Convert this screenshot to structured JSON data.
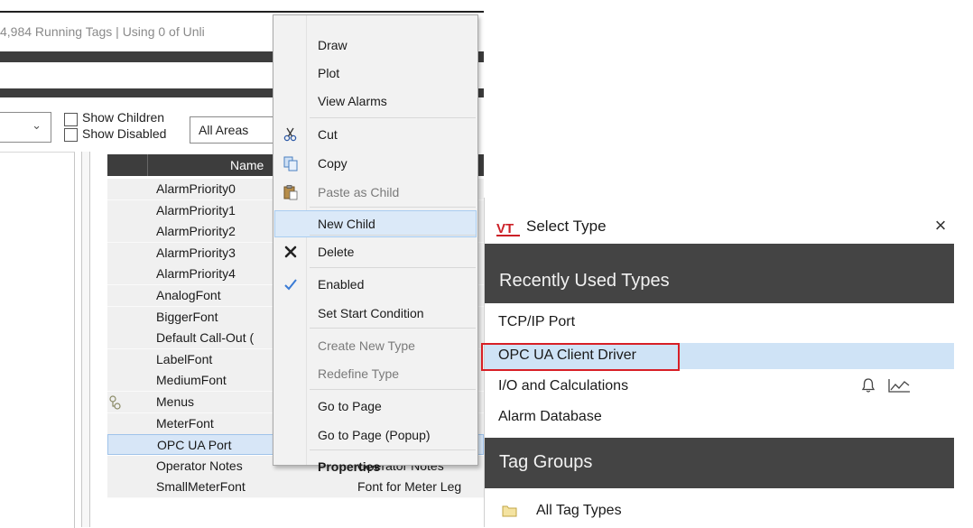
{
  "tag_browser": {
    "status_text": "4,984 Running Tags | Using 0 of Unli",
    "filters": {
      "show_children_label": "Show Children",
      "show_disabled_label": "Show Disabled",
      "area_value": "All Areas"
    },
    "grid": {
      "name_header": "Name",
      "rows": [
        {
          "name": "AlarmPriority0",
          "desc": ""
        },
        {
          "name": "AlarmPriority1",
          "desc": ""
        },
        {
          "name": "AlarmPriority2",
          "desc": ""
        },
        {
          "name": "AlarmPriority3",
          "desc": ""
        },
        {
          "name": "AlarmPriority4",
          "desc": ""
        },
        {
          "name": "AnalogFont",
          "desc": ""
        },
        {
          "name": "BiggerFont",
          "desc": ""
        },
        {
          "name": "Default Call-Out (",
          "desc": ""
        },
        {
          "name": "LabelFont",
          "desc": ""
        },
        {
          "name": "MediumFont",
          "desc": ""
        },
        {
          "name": "Menus",
          "desc": "",
          "icon": "tree-icon"
        },
        {
          "name": "MeterFont",
          "desc": ""
        },
        {
          "name": "OPC UA Port",
          "desc": "",
          "selected": true
        },
        {
          "name": "Operator Notes",
          "desc": "Operator Notes"
        },
        {
          "name": "SmallMeterFont",
          "desc": "Font for Meter Leg"
        }
      ]
    }
  },
  "context_menu": {
    "items": [
      {
        "label": "Draw"
      },
      {
        "label": "Plot"
      },
      {
        "label": "View Alarms"
      },
      {
        "label": "Cut",
        "icon": "scissors-icon"
      },
      {
        "label": "Copy",
        "icon": "copy-icon"
      },
      {
        "label": "Paste as Child",
        "icon": "paste-icon",
        "disabled": true
      },
      {
        "label": "New Child",
        "highlighted": true
      },
      {
        "label": "Delete",
        "icon": "delete-x-icon"
      },
      {
        "label": "Enabled",
        "icon": "checkmark-icon"
      },
      {
        "label": "Set Start Condition"
      },
      {
        "label": "Create New Type",
        "disabled": true
      },
      {
        "label": "Redefine Type",
        "disabled": true
      },
      {
        "label": "Go to Page"
      },
      {
        "label": "Go to Page (Popup)"
      },
      {
        "label": "Properties",
        "bold": true
      }
    ]
  },
  "select_type_dialog": {
    "logo_text": "VT",
    "title": "Select Type",
    "close_glyph": "×",
    "recent_header": "Recently Used Types",
    "recent_items": [
      {
        "label": "TCP/IP Port"
      },
      {
        "label": "OPC UA Client Driver",
        "selected": true
      },
      {
        "label": "I/O and Calculations",
        "icons": [
          "bell-icon",
          "trend-chart-icon"
        ]
      },
      {
        "label": "Alarm Database"
      }
    ],
    "groups_header": "Tag Groups",
    "group_items": [
      {
        "label": "All Tag Types",
        "icon": "folder-icon"
      }
    ],
    "colors": {
      "header_bg": "#444444",
      "selected_bg": "#cfe3f6",
      "highlight_box": "#d81f26",
      "logo_red": "#cc2027"
    }
  }
}
